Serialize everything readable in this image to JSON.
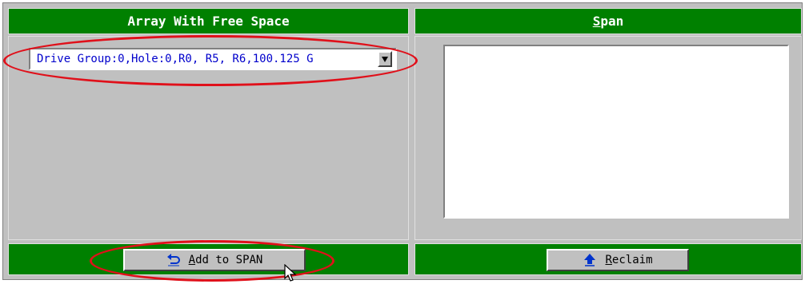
{
  "left_panel": {
    "header": "Array With Free Space",
    "select_value": "Drive Group:0,Hole:0,R0, R5, R6,100.125 G"
  },
  "right_panel": {
    "header": "Span",
    "list_items": []
  },
  "buttons": {
    "add_to_span": "Add to SPAN",
    "reclaim": "Reclaim"
  },
  "icons": {
    "add_icon": "undo-arrow-icon",
    "reclaim_icon": "up-arrow-icon",
    "dropdown_icon": "chevron-down-icon"
  },
  "colors": {
    "header_green": "#008000",
    "panel_gray": "#c0c0c0",
    "select_text": "#0000cc",
    "annotation_red": "#e0101a",
    "reclaim_arrow": "#0033cc"
  }
}
